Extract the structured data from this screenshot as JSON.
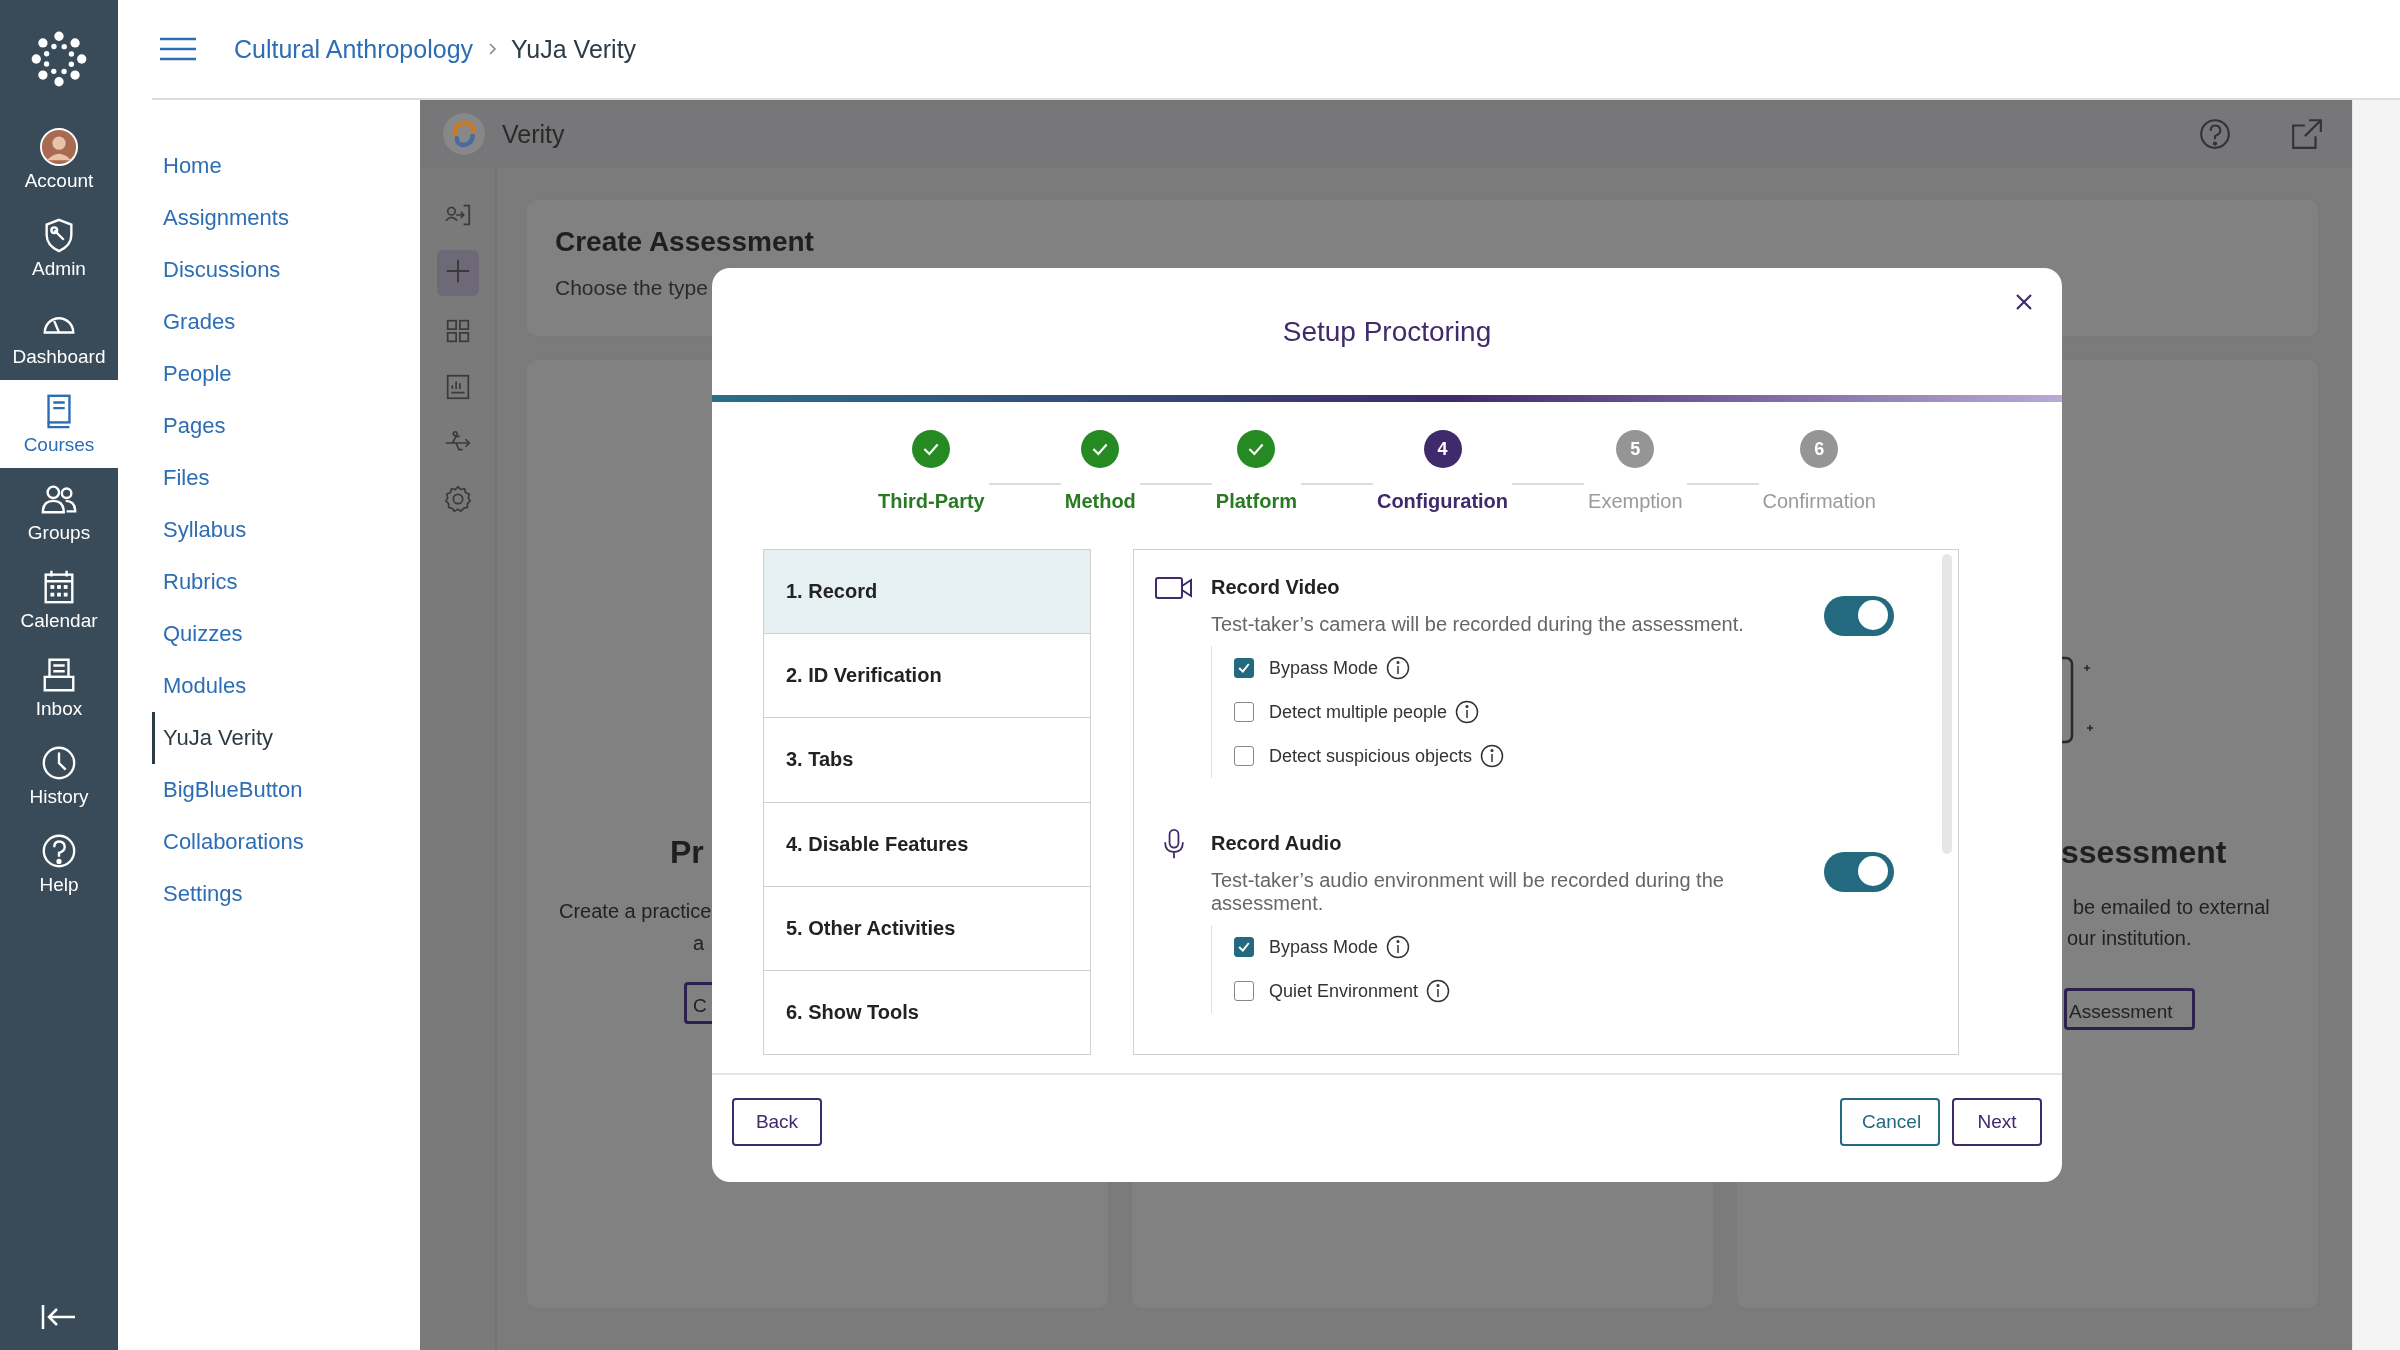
{
  "rail": {
    "items": [
      {
        "label": "Account",
        "selected": false
      },
      {
        "label": "Admin",
        "selected": false
      },
      {
        "label": "Dashboard",
        "selected": false
      },
      {
        "label": "Courses",
        "selected": true
      },
      {
        "label": "Groups",
        "selected": false
      },
      {
        "label": "Calendar",
        "selected": false
      },
      {
        "label": "Inbox",
        "selected": false
      },
      {
        "label": "History",
        "selected": false
      },
      {
        "label": "Help",
        "selected": false
      }
    ]
  },
  "breadcrumb": [
    "Cultural Anthropology",
    "YuJa Verity"
  ],
  "course_nav": [
    {
      "label": "Home",
      "selected": false
    },
    {
      "label": "Assignments",
      "selected": false
    },
    {
      "label": "Discussions",
      "selected": false
    },
    {
      "label": "Grades",
      "selected": false
    },
    {
      "label": "People",
      "selected": false
    },
    {
      "label": "Pages",
      "selected": false
    },
    {
      "label": "Files",
      "selected": false
    },
    {
      "label": "Syllabus",
      "selected": false
    },
    {
      "label": "Rubrics",
      "selected": false
    },
    {
      "label": "Quizzes",
      "selected": false
    },
    {
      "label": "Modules",
      "selected": false
    },
    {
      "label": "YuJa Verity",
      "selected": true
    },
    {
      "label": "BigBlueButton",
      "selected": false
    },
    {
      "label": "Collaborations",
      "selected": false
    },
    {
      "label": "Settings",
      "selected": false
    }
  ],
  "app": {
    "title": "Verity",
    "create_card": {
      "title": "Create Assessment",
      "subtitle": "Choose the type"
    },
    "left_card": {
      "heading": "Pr",
      "lines": [
        "Create a practice",
        "a"
      ],
      "button": "C"
    },
    "right_card": {
      "heading": "ssessment",
      "lines": [
        "be emailed to external",
        "our institution."
      ],
      "button": "Assessment"
    }
  },
  "modal": {
    "title": "Setup Proctoring",
    "steps": [
      {
        "label": "Third-Party",
        "done": true,
        "current": false
      },
      {
        "label": "Method",
        "done": true,
        "current": false
      },
      {
        "label": "Platform",
        "done": true,
        "current": false
      },
      {
        "label": "Configuration",
        "done": false,
        "current": true,
        "number": "4"
      },
      {
        "label": "Exemption",
        "done": false,
        "current": false,
        "number": "5"
      },
      {
        "label": "Confirmation",
        "done": false,
        "current": false,
        "number": "6"
      }
    ],
    "sections": [
      {
        "label": "1. Record",
        "selected": true
      },
      {
        "label": "2. ID Verification",
        "selected": false
      },
      {
        "label": "3. Tabs",
        "selected": false
      },
      {
        "label": "4. Disable Features",
        "selected": false
      },
      {
        "label": "5. Other Activities",
        "selected": false
      },
      {
        "label": "6. Show Tools",
        "selected": false
      }
    ],
    "config": [
      {
        "title": "Record Video",
        "description": "Test-taker’s camera will be recorded during the assessment.",
        "on": true,
        "options": [
          {
            "label": "Bypass Mode",
            "checked": true
          },
          {
            "label": "Detect multiple people",
            "checked": false
          },
          {
            "label": "Detect suspicious objects",
            "checked": false
          }
        ]
      },
      {
        "title": "Record Audio",
        "description": "Test-taker’s audio environment will be recorded during the assessment.",
        "on": true,
        "options": [
          {
            "label": "Bypass Mode",
            "checked": true
          },
          {
            "label": "Quiet Environment",
            "checked": false
          }
        ]
      }
    ],
    "buttons": {
      "back": "Back",
      "cancel": "Cancel",
      "next": "Next"
    }
  }
}
